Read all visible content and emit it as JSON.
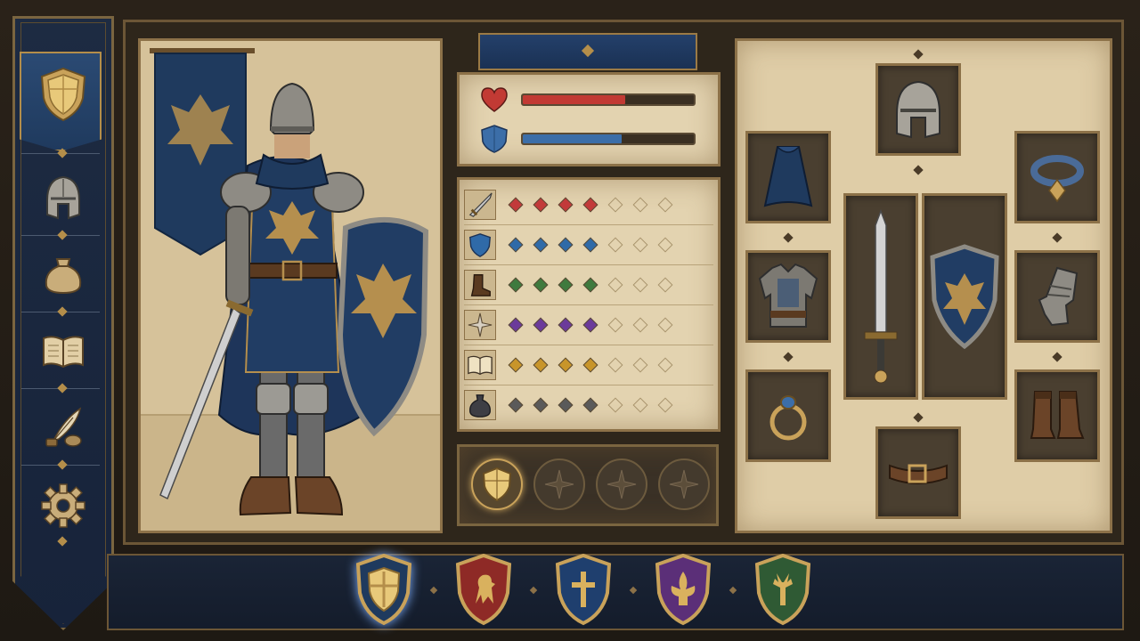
{
  "colors": {
    "gold": "#c9a25a",
    "navy": "#1f3a5e",
    "parchment": "#e3d3b0",
    "health": "#c23a34",
    "armor": "#3c6ea8"
  },
  "sidebar": {
    "items": [
      {
        "icon": "shield-crest-icon",
        "selected": true
      },
      {
        "icon": "helmet-icon",
        "selected": false
      },
      {
        "icon": "pouch-icon",
        "selected": false
      },
      {
        "icon": "book-icon",
        "selected": false
      },
      {
        "icon": "quill-ink-icon",
        "selected": false
      },
      {
        "icon": "gear-icon",
        "selected": false
      }
    ]
  },
  "bars": {
    "health": {
      "icon": "heart-icon",
      "fill": 0.6
    },
    "armor": {
      "icon": "shield-icon",
      "fill": 0.58
    }
  },
  "stats": [
    {
      "icon": "sword-icon",
      "color": "#c23a3a",
      "filled": 4,
      "max": 7
    },
    {
      "icon": "shield-icon",
      "color": "#2f6aa8",
      "filled": 4,
      "max": 7
    },
    {
      "icon": "boot-icon",
      "color": "#3f7a3e",
      "filled": 4,
      "max": 7
    },
    {
      "icon": "compass-star-icon",
      "color": "#6b3a9a",
      "filled": 4,
      "max": 7
    },
    {
      "icon": "book-icon",
      "color": "#c8952a",
      "filled": 4,
      "max": 7
    },
    {
      "icon": "coin-bag-icon",
      "color": "#5a5a5a",
      "filled": 4,
      "max": 7
    }
  ],
  "ability_slots": [
    {
      "icon": "shield-crest-icon",
      "active": true
    },
    {
      "icon": "compass-rose-icon",
      "active": false
    },
    {
      "icon": "compass-rose-icon",
      "active": false
    },
    {
      "icon": "compass-rose-icon",
      "active": false
    }
  ],
  "equipment": [
    {
      "slot": "head",
      "icon": "helmet-icon"
    },
    {
      "slot": "cloak",
      "icon": "cloak-icon"
    },
    {
      "slot": "neck",
      "icon": "collar-icon"
    },
    {
      "slot": "chest",
      "icon": "armor-icon"
    },
    {
      "slot": "main-hand",
      "icon": "sword-icon"
    },
    {
      "slot": "off-hand",
      "icon": "shield-icon"
    },
    {
      "slot": "hands",
      "icon": "gauntlet-icon"
    },
    {
      "slot": "ring",
      "icon": "ring-icon"
    },
    {
      "slot": "belt",
      "icon": "belt-icon"
    },
    {
      "slot": "feet",
      "icon": "boots-icon"
    }
  ],
  "crests": [
    {
      "icon": "shield-crest-icon",
      "color": "#1f3a5e",
      "selected": true
    },
    {
      "icon": "lion-crest-icon",
      "color": "#8e2a26",
      "selected": false
    },
    {
      "icon": "cross-crest-icon",
      "color": "#1f3f6e",
      "selected": false
    },
    {
      "icon": "fleur-de-lis-crest-icon",
      "color": "#5b2f78",
      "selected": false
    },
    {
      "icon": "stag-crest-icon",
      "color": "#2f5a34",
      "selected": false
    }
  ]
}
